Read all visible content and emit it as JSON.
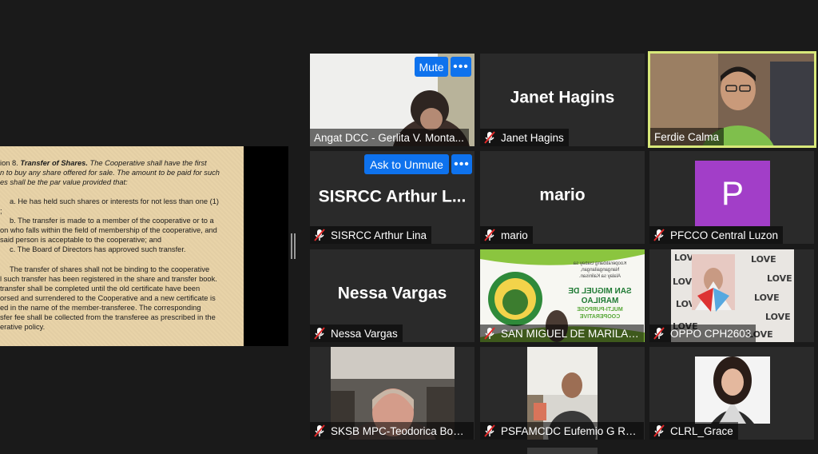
{
  "shared_doc": {
    "heading_bold": "Transfer of Shares.",
    "heading_prefix": "ion 8.",
    "lines": [
      "The Cooperative shall have the first",
      "n to buy any share offered for sale. The amount to be paid for such",
      "es shall be the par value provided that:",
      "a. He has held such shares or interests for not less than one (1)",
      ";",
      "b. The transfer is made to a member of the cooperative or to a",
      "on who falls within the field of membership of the cooperative, and",
      "said person is acceptable to the cooperative; and",
      "c. The Board of Directors has approved such transfer.",
      "The transfer of shares shall not be binding to the cooperative",
      "l such transfer has been registered in the share and transfer book.",
      "transfer shall be completed until the old certificate have been",
      "orsed and surrendered to the Cooperative and a new certificate is",
      "ed in the name of the member-transferee. The corresponding",
      "sfer fee shall be collected from the transferee as prescribed in the",
      "erative policy."
    ]
  },
  "controls": {
    "mute_label": "Mute",
    "ask_unmute_label": "Ask to Unmute",
    "more_label": "•••"
  },
  "participants": [
    {
      "name": "Angat DCC - Gerlita V. Monta...",
      "big_name": "",
      "muted": false,
      "video": true
    },
    {
      "name": "Janet Hagins",
      "big_name": "Janet Hagins",
      "muted": true,
      "video": false
    },
    {
      "name": "Ferdie Calma",
      "big_name": "",
      "muted": false,
      "video": true,
      "active_speaker": true
    },
    {
      "name": "SISRCC Arthur Lina",
      "big_name": "SISRCC Arthur L...",
      "muted": true,
      "video": false
    },
    {
      "name": "mario",
      "big_name": "mario",
      "muted": true,
      "video": false
    },
    {
      "name": "PFCCO Central Luzon",
      "big_name": "",
      "avatar_letter": "P",
      "muted": true,
      "video": false
    },
    {
      "name": "Nessa Vargas",
      "big_name": "Nessa Vargas",
      "muted": true,
      "video": false
    },
    {
      "name": "SAN MIGUEL DE MARILAO...",
      "big_name": "",
      "muted": true,
      "video": true
    },
    {
      "name": "OPPO CPH2603",
      "big_name": "",
      "muted": true,
      "video": true
    },
    {
      "name": "SKSB MPC-Teodorica Bonif...",
      "big_name": "",
      "muted": true,
      "video": true
    },
    {
      "name": "PSFAMCDC Eufemio G Ru...",
      "big_name": "",
      "muted": true,
      "video": true
    },
    {
      "name": "CLRL_Grace",
      "big_name": "",
      "muted": true,
      "video": true
    }
  ],
  "banner": {
    "line1": "SAN MIGUEL DE MARILAO",
    "line2": "MULTI-PURPOSE COOPERATIVE",
    "tag1": "Kooperatibang Gabay sa Nangangailangan,",
    "tag2": "Alalay sa Kalinisan."
  },
  "love_wall": "LOVE",
  "colors": {
    "accent_blue": "#0e72ed",
    "mic_muted_red": "#e02828",
    "active_border": "#d8e87a",
    "avatar_purple": "#a23ec8",
    "tile_bg": "#2a2a2a"
  }
}
